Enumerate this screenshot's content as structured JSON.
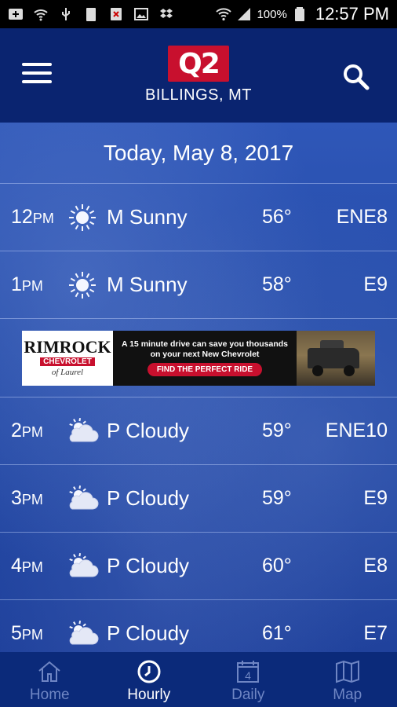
{
  "status_bar": {
    "battery": "100%",
    "time": "12:57 PM"
  },
  "header": {
    "logo_text": "Q2",
    "location": "BILLINGS, MT"
  },
  "date_label": "Today, May 8, 2017",
  "hours_before_ad": [
    {
      "hour": "12",
      "period": "PM",
      "icon": "sun-icon",
      "condition": "M Sunny",
      "temp": "56°",
      "wind": "ENE8"
    },
    {
      "hour": "1",
      "period": "PM",
      "icon": "sun-icon",
      "condition": "M Sunny",
      "temp": "58°",
      "wind": "E9"
    }
  ],
  "ad": {
    "brand": "RIMROCK",
    "sub": "CHEVROLET",
    "place": "of Laurel",
    "line1": "A 15 minute drive can save you thousands",
    "line2": "on your next New Chevrolet",
    "cta": "FIND THE PERFECT RIDE"
  },
  "hours_after_ad": [
    {
      "hour": "2",
      "period": "PM",
      "icon": "partly-cloudy-icon",
      "condition": "P Cloudy",
      "temp": "59°",
      "wind": "ENE10"
    },
    {
      "hour": "3",
      "period": "PM",
      "icon": "partly-cloudy-icon",
      "condition": "P Cloudy",
      "temp": "59°",
      "wind": "E9"
    },
    {
      "hour": "4",
      "period": "PM",
      "icon": "partly-cloudy-icon",
      "condition": "P Cloudy",
      "temp": "60°",
      "wind": "E8"
    },
    {
      "hour": "5",
      "period": "PM",
      "icon": "partly-cloudy-icon",
      "condition": "P Cloudy",
      "temp": "61°",
      "wind": "E7"
    }
  ],
  "nav": {
    "home": "Home",
    "hourly": "Hourly",
    "daily": "Daily",
    "daily_icon_number": "4",
    "map": "Map"
  },
  "colors": {
    "header_bg": "#0a2470",
    "accent_red": "#c8102e",
    "nav_inactive": "#6f86c4",
    "nav_active": "#ffffff"
  }
}
